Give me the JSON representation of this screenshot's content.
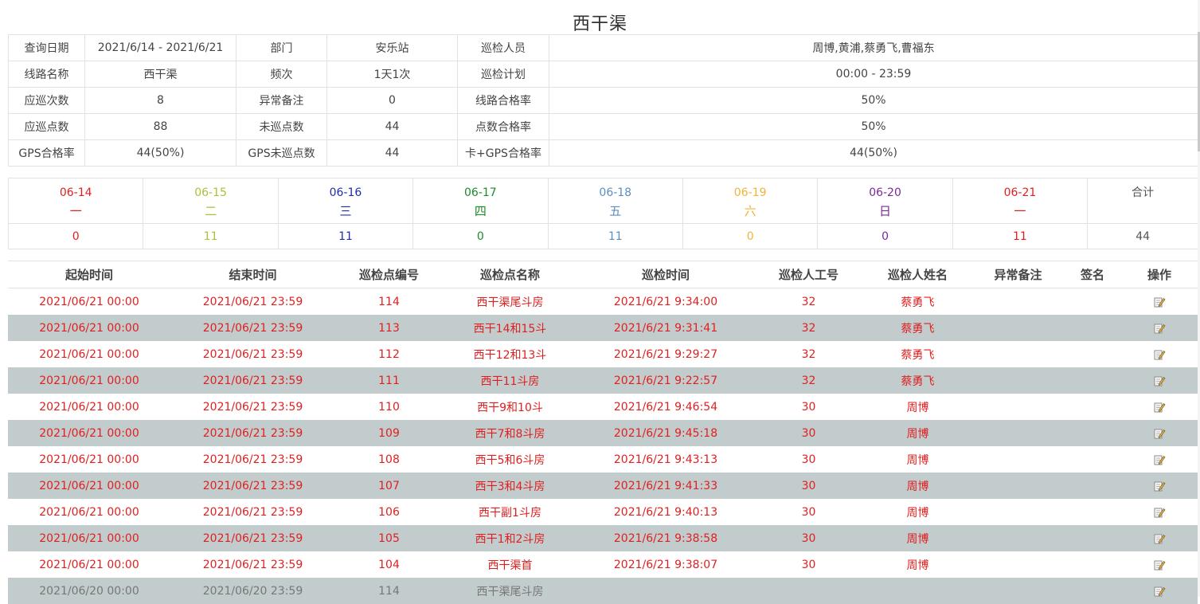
{
  "title": "西干渠",
  "info": [
    [
      {
        "label": "查询日期",
        "value": "2021/6/14 - 2021/6/21"
      },
      {
        "label": "部门",
        "value": "安乐站"
      },
      {
        "label": "巡检人员",
        "value": "周博,黄浦,蔡勇飞,曹福东"
      }
    ],
    [
      {
        "label": "线路名称",
        "value": "西干渠"
      },
      {
        "label": "频次",
        "value": "1天1次"
      },
      {
        "label": "巡检计划",
        "value": "00:00 - 23:59"
      }
    ],
    [
      {
        "label": "应巡次数",
        "value": "8"
      },
      {
        "label": "异常备注",
        "value": "0"
      },
      {
        "label": "线路合格率",
        "value": "50%"
      }
    ],
    [
      {
        "label": "应巡点数",
        "value": "88"
      },
      {
        "label": "未巡点数",
        "value": "44"
      },
      {
        "label": "点数合格率",
        "value": "50%"
      }
    ],
    [
      {
        "label": "GPS合格率",
        "value": "44(50%)"
      },
      {
        "label": "GPS未巡点数",
        "value": "44"
      },
      {
        "label": "卡+GPS合格率",
        "value": "44(50%)"
      }
    ]
  ],
  "days": [
    {
      "date": "06-14",
      "weekday": "一",
      "count": "0",
      "color": "#e02020"
    },
    {
      "date": "06-15",
      "weekday": "二",
      "count": "11",
      "color": "#a8c33a"
    },
    {
      "date": "06-16",
      "weekday": "三",
      "count": "11",
      "color": "#1f2ea8"
    },
    {
      "date": "06-17",
      "weekday": "四",
      "count": "0",
      "color": "#1d8a2a"
    },
    {
      "date": "06-18",
      "weekday": "五",
      "count": "11",
      "color": "#5b8fc0"
    },
    {
      "date": "06-19",
      "weekday": "六",
      "count": "0",
      "color": "#f0b43a"
    },
    {
      "date": "06-20",
      "weekday": "日",
      "count": "0",
      "color": "#7a2a9a"
    },
    {
      "date": "06-21",
      "weekday": "一",
      "count": "11",
      "color": "#e02020"
    }
  ],
  "total": {
    "label": "合计",
    "value": "44"
  },
  "records_header": [
    "起始时间",
    "结束时间",
    "巡检点编号",
    "巡检点名称",
    "巡检时间",
    "巡检人工号",
    "巡检人姓名",
    "异常备注",
    "签名",
    "操作"
  ],
  "records": [
    {
      "start": "2021/06/21 00:00",
      "end": "2021/06/21 23:59",
      "code": "114",
      "name": "西干渠尾斗房",
      "time": "2021/6/21 9:34:00",
      "emp_id": "32",
      "emp_name": "蔡勇飞",
      "note": "",
      "sign": ""
    },
    {
      "start": "2021/06/21 00:00",
      "end": "2021/06/21 23:59",
      "code": "113",
      "name": "西干14和15斗",
      "time": "2021/6/21 9:31:41",
      "emp_id": "32",
      "emp_name": "蔡勇飞",
      "note": "",
      "sign": ""
    },
    {
      "start": "2021/06/21 00:00",
      "end": "2021/06/21 23:59",
      "code": "112",
      "name": "西干12和13斗",
      "time": "2021/6/21 9:29:27",
      "emp_id": "32",
      "emp_name": "蔡勇飞",
      "note": "",
      "sign": ""
    },
    {
      "start": "2021/06/21 00:00",
      "end": "2021/06/21 23:59",
      "code": "111",
      "name": "西干11斗房",
      "time": "2021/6/21 9:22:57",
      "emp_id": "32",
      "emp_name": "蔡勇飞",
      "note": "",
      "sign": ""
    },
    {
      "start": "2021/06/21 00:00",
      "end": "2021/06/21 23:59",
      "code": "110",
      "name": "西干9和10斗",
      "time": "2021/6/21 9:46:54",
      "emp_id": "30",
      "emp_name": "周博",
      "note": "",
      "sign": ""
    },
    {
      "start": "2021/06/21 00:00",
      "end": "2021/06/21 23:59",
      "code": "109",
      "name": "西干7和8斗房",
      "time": "2021/6/21 9:45:18",
      "emp_id": "30",
      "emp_name": "周博",
      "note": "",
      "sign": ""
    },
    {
      "start": "2021/06/21 00:00",
      "end": "2021/06/21 23:59",
      "code": "108",
      "name": "西干5和6斗房",
      "time": "2021/6/21 9:43:13",
      "emp_id": "30",
      "emp_name": "周博",
      "note": "",
      "sign": ""
    },
    {
      "start": "2021/06/21 00:00",
      "end": "2021/06/21 23:59",
      "code": "107",
      "name": "西干3和4斗房",
      "time": "2021/6/21 9:41:33",
      "emp_id": "30",
      "emp_name": "周博",
      "note": "",
      "sign": ""
    },
    {
      "start": "2021/06/21 00:00",
      "end": "2021/06/21 23:59",
      "code": "106",
      "name": "西干副1斗房",
      "time": "2021/6/21 9:40:13",
      "emp_id": "30",
      "emp_name": "周博",
      "note": "",
      "sign": ""
    },
    {
      "start": "2021/06/21 00:00",
      "end": "2021/06/21 23:59",
      "code": "105",
      "name": "西干1和2斗房",
      "time": "2021/6/21 9:38:58",
      "emp_id": "30",
      "emp_name": "周博",
      "note": "",
      "sign": ""
    },
    {
      "start": "2021/06/21 00:00",
      "end": "2021/06/21 23:59",
      "code": "104",
      "name": "西干渠首",
      "time": "2021/6/21 9:38:07",
      "emp_id": "30",
      "emp_name": "周博",
      "note": "",
      "sign": ""
    },
    {
      "start": "2021/06/20 00:00",
      "end": "2021/06/20 23:59",
      "code": "114",
      "name": "西干渠尾斗房",
      "time": "",
      "emp_id": "",
      "emp_name": "",
      "note": "",
      "sign": "",
      "muted": true
    }
  ],
  "action_icon": "edit-icon"
}
